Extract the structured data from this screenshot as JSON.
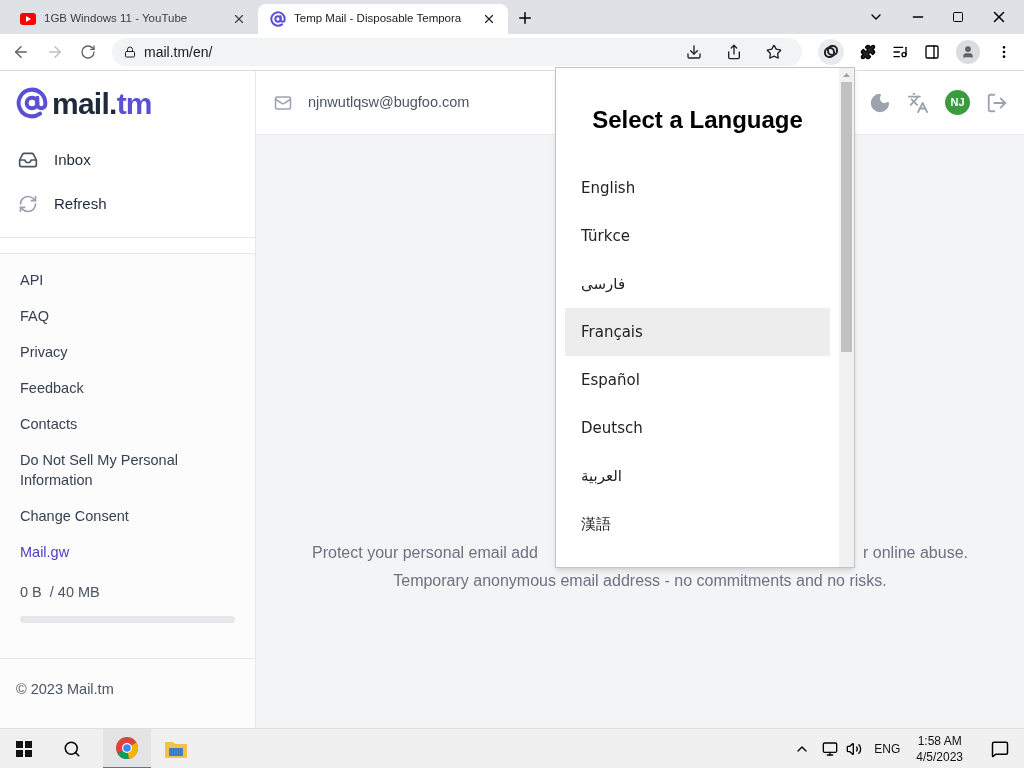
{
  "browser": {
    "tabs": [
      {
        "title": "1GB Windows 11 - YouTube",
        "selected": false,
        "kind": "video"
      },
      {
        "title": "Temp Mail - Disposable Tempora",
        "selected": true,
        "kind": "mail"
      }
    ],
    "address": "mail.tm/en/"
  },
  "sidebar": {
    "logo": {
      "part_1": "mail.",
      "part_2": "tm"
    },
    "nav": [
      {
        "label": "Inbox",
        "kind": "inbox"
      },
      {
        "label": "Refresh",
        "kind": "refresh"
      }
    ],
    "links": [
      {
        "label": "API",
        "accent": false
      },
      {
        "label": "FAQ",
        "accent": false
      },
      {
        "label": "Privacy",
        "accent": false
      },
      {
        "label": "Feedback",
        "accent": false
      },
      {
        "label": "Contacts",
        "accent": false
      },
      {
        "label": "Do Not Sell My Personal Information",
        "accent": false
      },
      {
        "label": "Change Consent",
        "accent": false
      },
      {
        "label": "Mail.gw",
        "accent": true
      }
    ],
    "storage": {
      "used": "0 B",
      "total": "/ 40 MB",
      "level": 0
    },
    "footer": "© 2023 Mail.tm"
  },
  "header": {
    "email": "njnwutlqsw@bugfoo.com",
    "avatar": "NJ"
  },
  "main": {
    "line_1_left": "Protect your personal email add",
    "line_1_right": "r online abuse.",
    "line_2": "Temporary anonymous email address - no commitments and no risks."
  },
  "language_popup": {
    "title": "Select a Language",
    "languages": [
      {
        "label": "English",
        "highlighted": false
      },
      {
        "label": "Türkce",
        "highlighted": false
      },
      {
        "label": "فارسی",
        "highlighted": false
      },
      {
        "label": "Français",
        "highlighted": true
      },
      {
        "label": "Español",
        "highlighted": false
      },
      {
        "label": "Deutsch",
        "highlighted": false
      },
      {
        "label": "العربية",
        "highlighted": false
      },
      {
        "label": "漢語",
        "highlighted": false
      }
    ]
  },
  "taskbar": {
    "language": "ENG",
    "time": "1:58 AM",
    "date": "4/5/2023"
  }
}
